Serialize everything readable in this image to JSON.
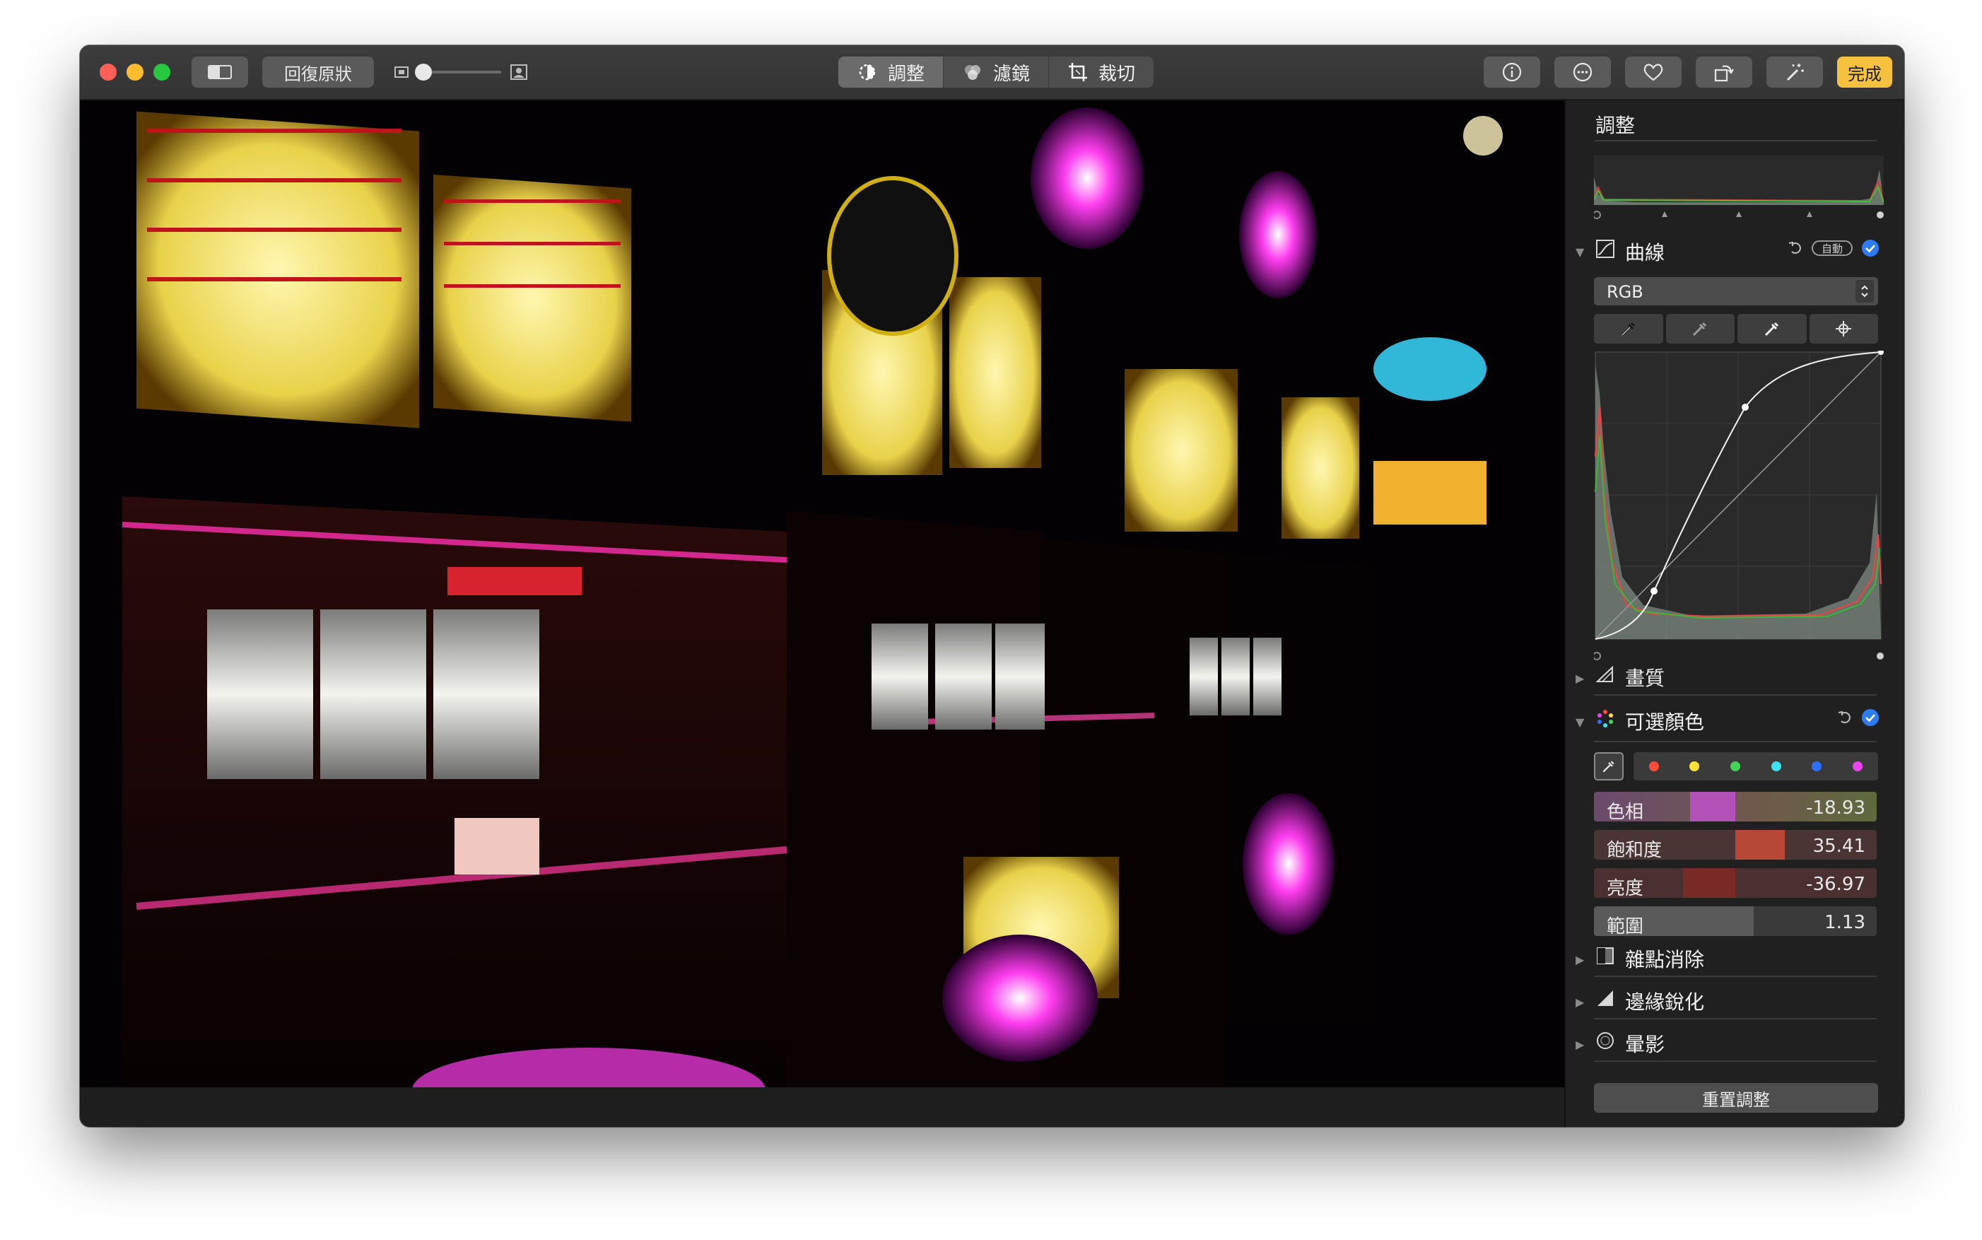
{
  "toolbar": {
    "revert_label": "回復原狀",
    "tabs": [
      {
        "label": "調整",
        "icon": "adjust-icon"
      },
      {
        "label": "濾鏡",
        "icon": "filters-icon"
      },
      {
        "label": "裁切",
        "icon": "crop-icon"
      }
    ],
    "done_label": "完成"
  },
  "sidebar": {
    "header": "調整",
    "curves": {
      "label": "曲線",
      "auto_label": "自動",
      "channel": "RGB"
    },
    "definition": {
      "label": "畫質"
    },
    "selective_color": {
      "label": "可選顏色",
      "swatches": [
        "#ff4b3a",
        "#ffe234",
        "#41d35a",
        "#3fe0f0",
        "#2f6fff",
        "#e845f0"
      ],
      "sliders": [
        {
          "label": "色相",
          "value": "-18.93"
        },
        {
          "label": "飽和度",
          "value": "35.41"
        },
        {
          "label": "亮度",
          "value": "-36.97"
        },
        {
          "label": "範圍",
          "value": "1.13"
        }
      ]
    },
    "noise_reduction": {
      "label": "雜點消除"
    },
    "sharpen": {
      "label": "邊緣銳化"
    },
    "vignette": {
      "label": "暈影"
    },
    "reset_label": "重置調整"
  },
  "colors": {
    "accent": "#2d7cf6",
    "done_bg": "#f6c23e",
    "panel": "#202020"
  }
}
